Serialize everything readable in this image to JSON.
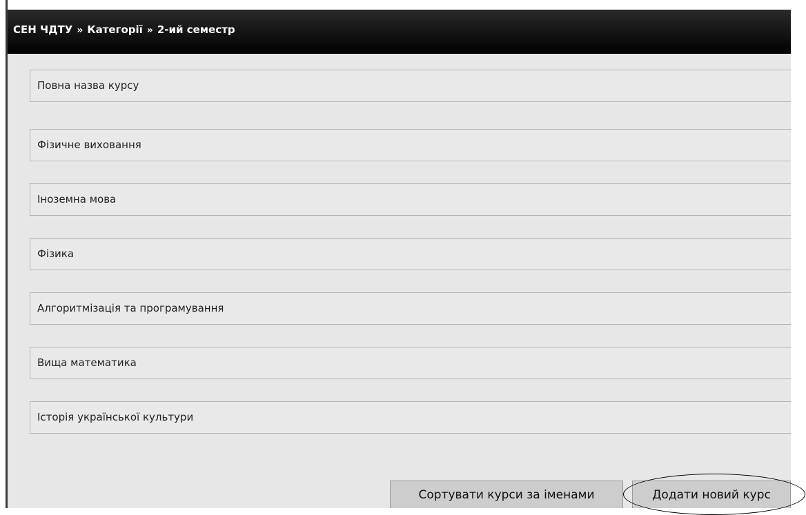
{
  "breadcrumb": {
    "items": [
      "СЕН ЧДТУ",
      "Категорії",
      "2-ий семестр"
    ],
    "separator": "»"
  },
  "courses": {
    "header": "Повна назва курсу",
    "items": [
      "Фізичне виховання",
      "Іноземна мова",
      "Фізика",
      "Алгоритмізація та програмування",
      "Вища математика",
      "Історія української культури"
    ]
  },
  "actions": {
    "sort_label": "Сортувати курси за іменами",
    "add_label": "Додати новий курс"
  },
  "colors": {
    "navbar": "#000000",
    "panel": "#e7e7e7",
    "button": "#cdcdcd"
  }
}
